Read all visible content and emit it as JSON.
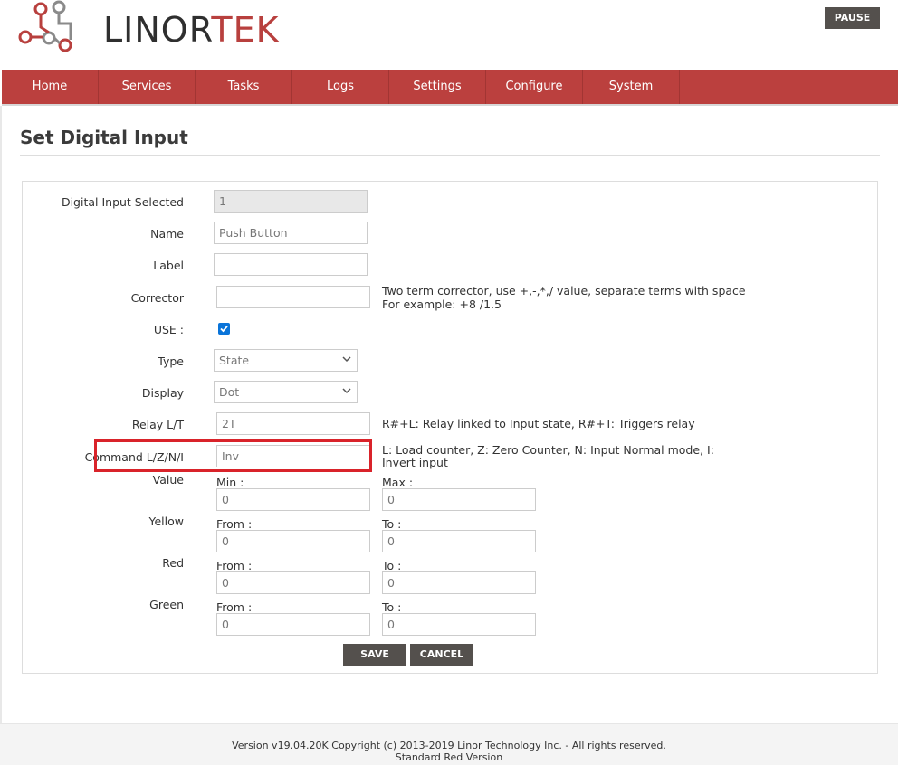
{
  "header": {
    "logo_part1": "LINOR",
    "logo_part2": "TEK",
    "pause_label": "PAUSE"
  },
  "nav": [
    "Home",
    "Services",
    "Tasks",
    "Logs",
    "Settings",
    "Configure",
    "System"
  ],
  "page_title": "Set Digital Input",
  "form": {
    "digital_input_label": "Digital Input Selected",
    "digital_input_value": "1",
    "name_label": "Name",
    "name_value": "Push Button",
    "label_label": "Label",
    "label_value": "",
    "corrector_label": "Corrector",
    "corrector_value": "",
    "corrector_help_1": "Two term corrector, use +,-,*,/ value, separate terms with space",
    "corrector_help_2": "For example: +8 /1.5",
    "use_label": "USE :",
    "use_checked": true,
    "type_label": "Type",
    "type_value": "State",
    "display_label": "Display",
    "display_value": "Dot",
    "relay_label": "Relay L/T",
    "relay_value": "2T",
    "relay_help": "R#+L: Relay linked to Input state, R#+T: Triggers relay",
    "command_label": "Command L/Z/N/I",
    "command_value": "Inv",
    "command_help_1": "L: Load counter, Z: Zero Counter, N: Input Normal mode, I:",
    "command_help_2": "Invert input",
    "value_label": "Value",
    "min_label": "Min :",
    "min_value": "0",
    "max_label": "Max :",
    "max_value": "0",
    "yellow_label": "Yellow",
    "yellow_from_label": "From :",
    "yellow_from_value": "0",
    "yellow_to_label": "To :",
    "yellow_to_value": "0",
    "red_label": "Red",
    "red_from_label": "From :",
    "red_from_value": "0",
    "red_to_label": "To :",
    "red_to_value": "0",
    "green_label": "Green",
    "green_from_label": "From :",
    "green_from_value": "0",
    "green_to_label": "To :",
    "green_to_value": "0",
    "save_label": "SAVE",
    "cancel_label": "CANCEL"
  },
  "footer": {
    "line1": "Version v19.04.20K Copyright (c) 2013-2019 Linor Technology Inc. - All rights reserved.",
    "line2": "Standard Red Version"
  },
  "colors": {
    "brand_red": "#bb403e",
    "button_dark": "#54504d",
    "highlight_red": "#d9232a",
    "checkbox_blue": "#0a74d9"
  }
}
